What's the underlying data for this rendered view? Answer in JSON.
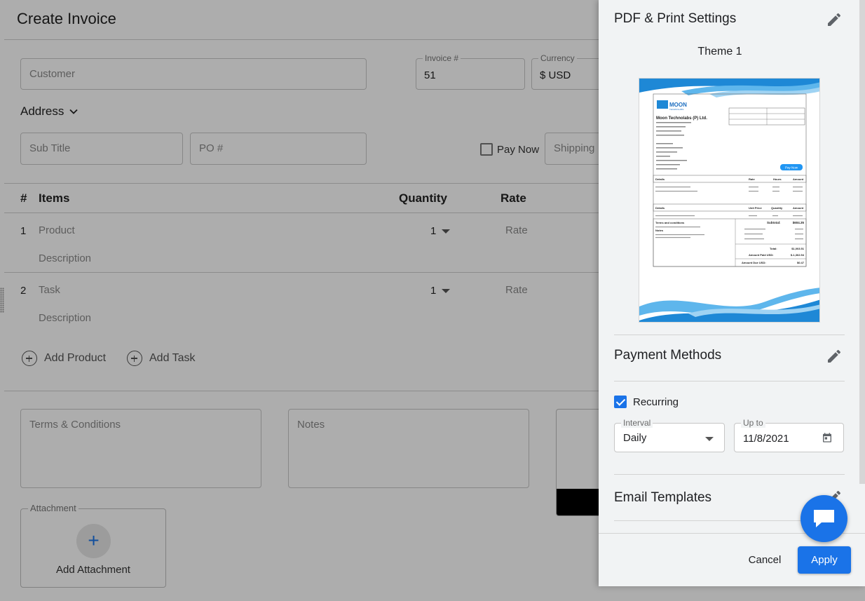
{
  "page": {
    "title": "Create Invoice"
  },
  "form": {
    "customer_placeholder": "Customer",
    "invoice_label": "Invoice #",
    "invoice_value": "51",
    "currency_label": "Currency",
    "currency_value": "$ USD",
    "address_label": "Address",
    "subtitle_placeholder": "Sub Title",
    "po_placeholder": "PO #",
    "pay_now_label": "Pay Now",
    "shipping_placeholder": "Shipping"
  },
  "table": {
    "headers": {
      "num": "#",
      "items": "Items",
      "quantity": "Quantity",
      "rate": "Rate"
    },
    "rows": [
      {
        "num": "1",
        "name": "Product",
        "description": "Description",
        "quantity": "1",
        "rate": "Rate"
      },
      {
        "num": "2",
        "name": "Task",
        "description": "Description",
        "quantity": "1",
        "rate": "Rate"
      }
    ]
  },
  "actions": {
    "add_product": "Add Product",
    "add_task": "Add Task"
  },
  "bottom": {
    "terms_placeholder": "Terms & Conditions",
    "notes_placeholder": "Notes",
    "attachment_label": "Attachment",
    "add_attachment": "Add Attachment",
    "add_attachment_icon": "+"
  },
  "drawer": {
    "pdf_title": "PDF & Print Settings",
    "theme_name": "Theme 1",
    "payment_title": "Payment Methods",
    "recurring_label": "Recurring",
    "recurring_checked": true,
    "interval_label": "Interval",
    "interval_value": "Daily",
    "upto_label": "Up to",
    "upto_value": "11/8/2021",
    "email_title": "Email Templates",
    "cancel_label": "Cancel",
    "apply_label": "Apply"
  },
  "thumbnail": {
    "company_logo": "MOON",
    "company_logo_sub": "TECHNOLABS",
    "company_name": "Moon Technolabs (P) Ltd.",
    "pay_now": "Pay Now",
    "col_details": "Details",
    "col_rate": "Rate",
    "col_hours": "Hours",
    "col_amount": "Amount",
    "col_unit_price": "Unit Price",
    "col_quantity": "Quantity",
    "terms": "Terms and conditions",
    "notes": "Notes",
    "subtotal_label": "Subtotal:",
    "subtotal": "$604.35",
    "total_label": "Total:",
    "total": "$1,003.51",
    "paid_label": "Amount Paid USD:",
    "paid": "$-1,362.54",
    "due_label": "Amount Due USD:",
    "due": "$0.47"
  },
  "colors": {
    "accent": "#1a73e8",
    "overlay": "rgba(0,0,0,0.32)",
    "drawer_bg": "#f1f3f4"
  }
}
